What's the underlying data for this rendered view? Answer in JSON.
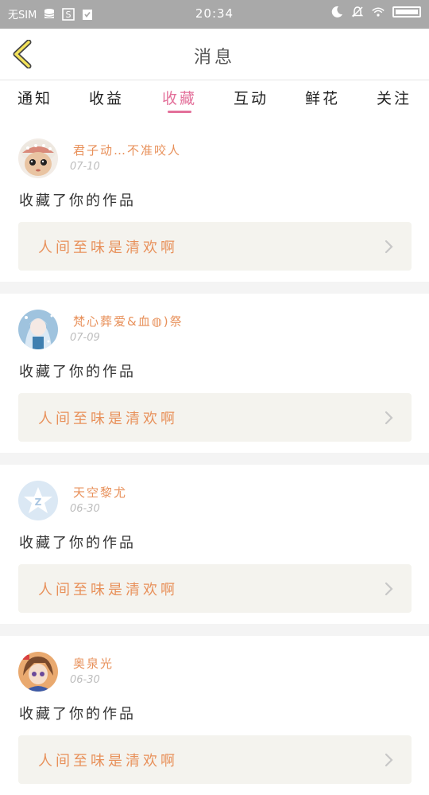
{
  "status_bar": {
    "carrier": "无SIM",
    "time": "20:34"
  },
  "header": {
    "title": "消息"
  },
  "tabs": [
    {
      "label": "通知",
      "active": false
    },
    {
      "label": "收益",
      "active": false
    },
    {
      "label": "收藏",
      "active": true
    },
    {
      "label": "互动",
      "active": false
    },
    {
      "label": "鲜花",
      "active": false
    },
    {
      "label": "关注",
      "active": false
    }
  ],
  "colors": {
    "accent_tab": "#e3709a",
    "username": "#e8915b",
    "work_title": "#e8915b",
    "status_bar": "#a9a9a9"
  },
  "messages": [
    {
      "username": "君子动…不准咬人",
      "date": "07-10",
      "action": "收藏了你的作品",
      "work_title": "人间至味是清欢啊",
      "avatar_icon": "doll-avatar-icon"
    },
    {
      "username": "梵心葬爱&血◍)祭",
      "date": "07-09",
      "action": "收藏了你的作品",
      "work_title": "人间至味是清欢啊",
      "avatar_icon": "anime-girl-avatar-icon"
    },
    {
      "username": "天空黎尤",
      "date": "06-30",
      "action": "收藏了你的作品",
      "work_title": "人间至味是清欢啊",
      "avatar_icon": "qzone-star-avatar-icon"
    },
    {
      "username": "奥泉光",
      "date": "06-30",
      "action": "收藏了你的作品",
      "work_title": "人间至味是清欢啊",
      "avatar_icon": "anime-boy-avatar-icon"
    }
  ]
}
